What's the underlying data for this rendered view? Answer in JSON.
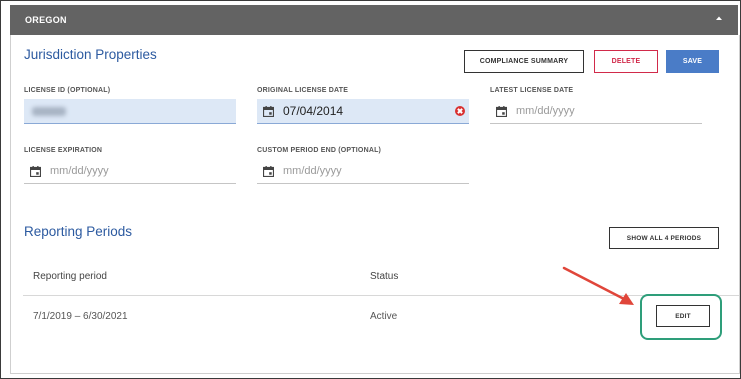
{
  "header": {
    "title": "OREGON",
    "collapse_icon": "chevron-up-icon"
  },
  "jurisdiction": {
    "title": "Jurisdiction Properties",
    "buttons": {
      "compliance": "COMPLIANCE SUMMARY",
      "delete": "DELETE",
      "save": "SAVE"
    },
    "fields": {
      "license_id": {
        "label": "LICENSE ID (OPTIONAL)",
        "value": ""
      },
      "original_date": {
        "label": "ORIGINAL LICENSE DATE",
        "value": "07/04/2014"
      },
      "latest_date": {
        "label": "LATEST LICENSE DATE",
        "placeholder": "mm/dd/yyyy"
      },
      "expiration": {
        "label": "LICENSE EXPIRATION",
        "placeholder": "mm/dd/yyyy"
      },
      "custom_end": {
        "label": "CUSTOM PERIOD END (OPTIONAL)",
        "placeholder": "mm/dd/yyyy"
      }
    }
  },
  "reporting": {
    "title": "Reporting Periods",
    "show_all": "SHOW ALL 4 PERIODS",
    "columns": {
      "period": "Reporting period",
      "status": "Status"
    },
    "rows": [
      {
        "period": "7/1/2019 – 6/30/2021",
        "status": "Active",
        "action": "EDIT"
      }
    ]
  },
  "colors": {
    "accent": "#2c5aa0",
    "delete": "#d12a4a",
    "save": "#4a7cc7",
    "highlight": "#2e9e7a",
    "arrow": "#e0463a"
  }
}
